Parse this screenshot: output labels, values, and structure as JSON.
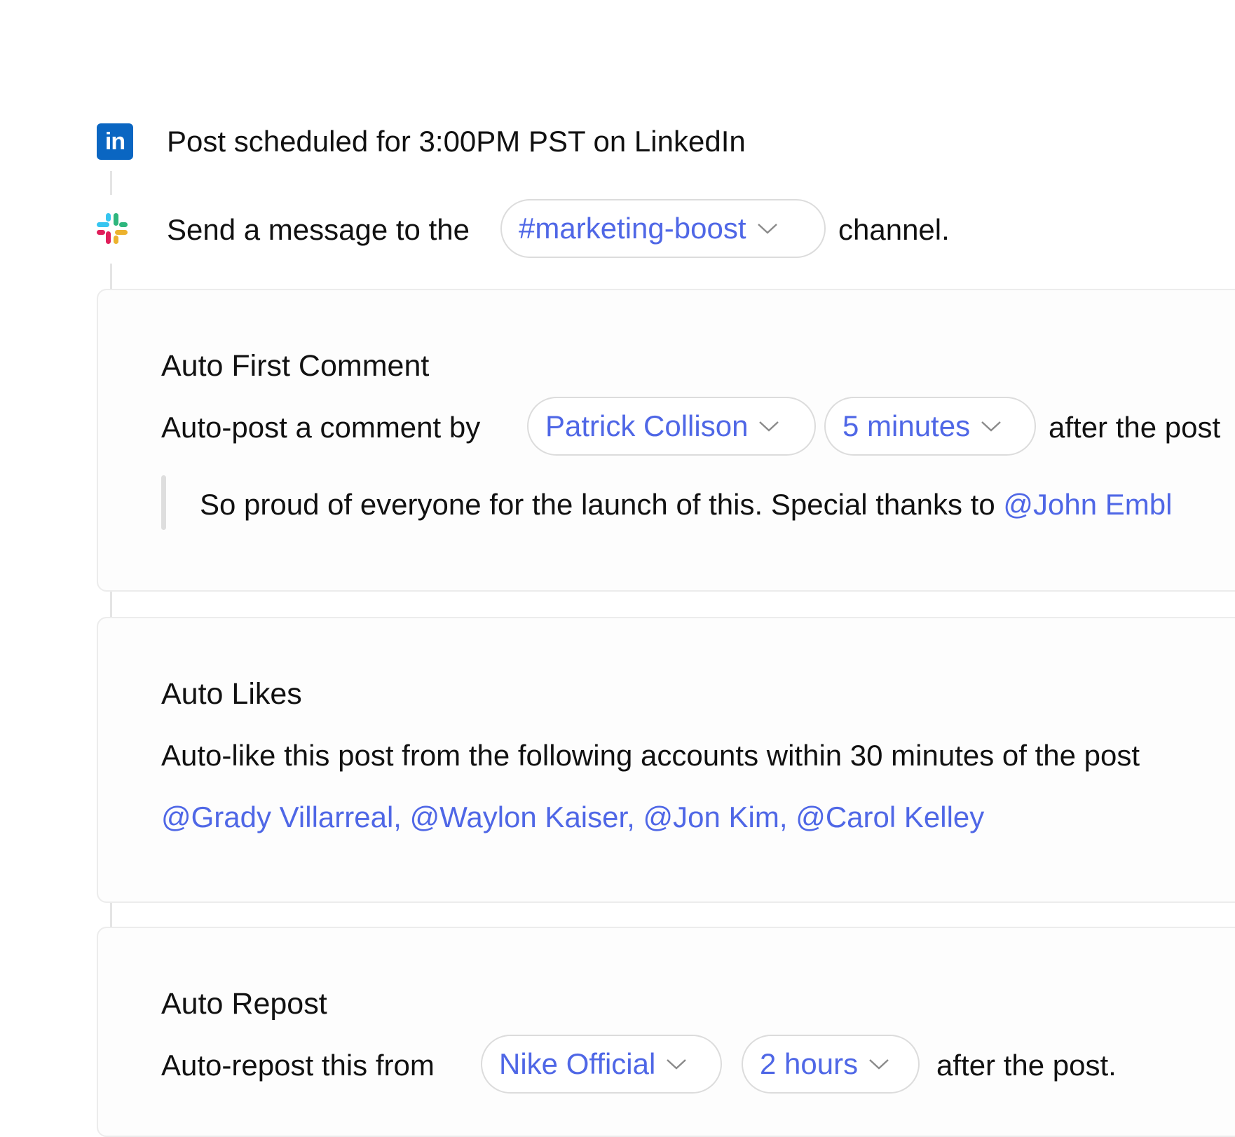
{
  "timeline": {
    "linkedin": {
      "icon": "linkedin-icon",
      "icon_text": "in",
      "text": "Post scheduled for 3:00PM PST on LinkedIn"
    },
    "slack": {
      "icon": "slack-icon",
      "text_before": "Send a message to the",
      "channel": "#marketing-boost",
      "text_after": "channel."
    }
  },
  "cards": {
    "first_comment": {
      "title": "Auto First Comment",
      "text_before": "Auto-post a comment by",
      "user": "Patrick Collison",
      "delay": "5 minutes",
      "text_after": "after the post",
      "comment_text": "So proud of everyone for the launch of this. Special thanks to",
      "comment_mention": "@John Embl"
    },
    "likes": {
      "title": "Auto Likes",
      "description": "Auto-like this post from the following accounts within 30 minutes of the post",
      "accounts": "@Grady Villarreal, @Waylon Kaiser, @Jon Kim, @Carol Kelley"
    },
    "repost": {
      "title": "Auto Repost",
      "text_before": "Auto-repost this from",
      "account": "Nike Official",
      "delay": "2 hours",
      "text_after": "after the post."
    }
  },
  "colors": {
    "accent": "#4f67e6",
    "linkedin": "#0a66c2",
    "border": "#dcdcdc",
    "connector": "#e4e4e4"
  }
}
